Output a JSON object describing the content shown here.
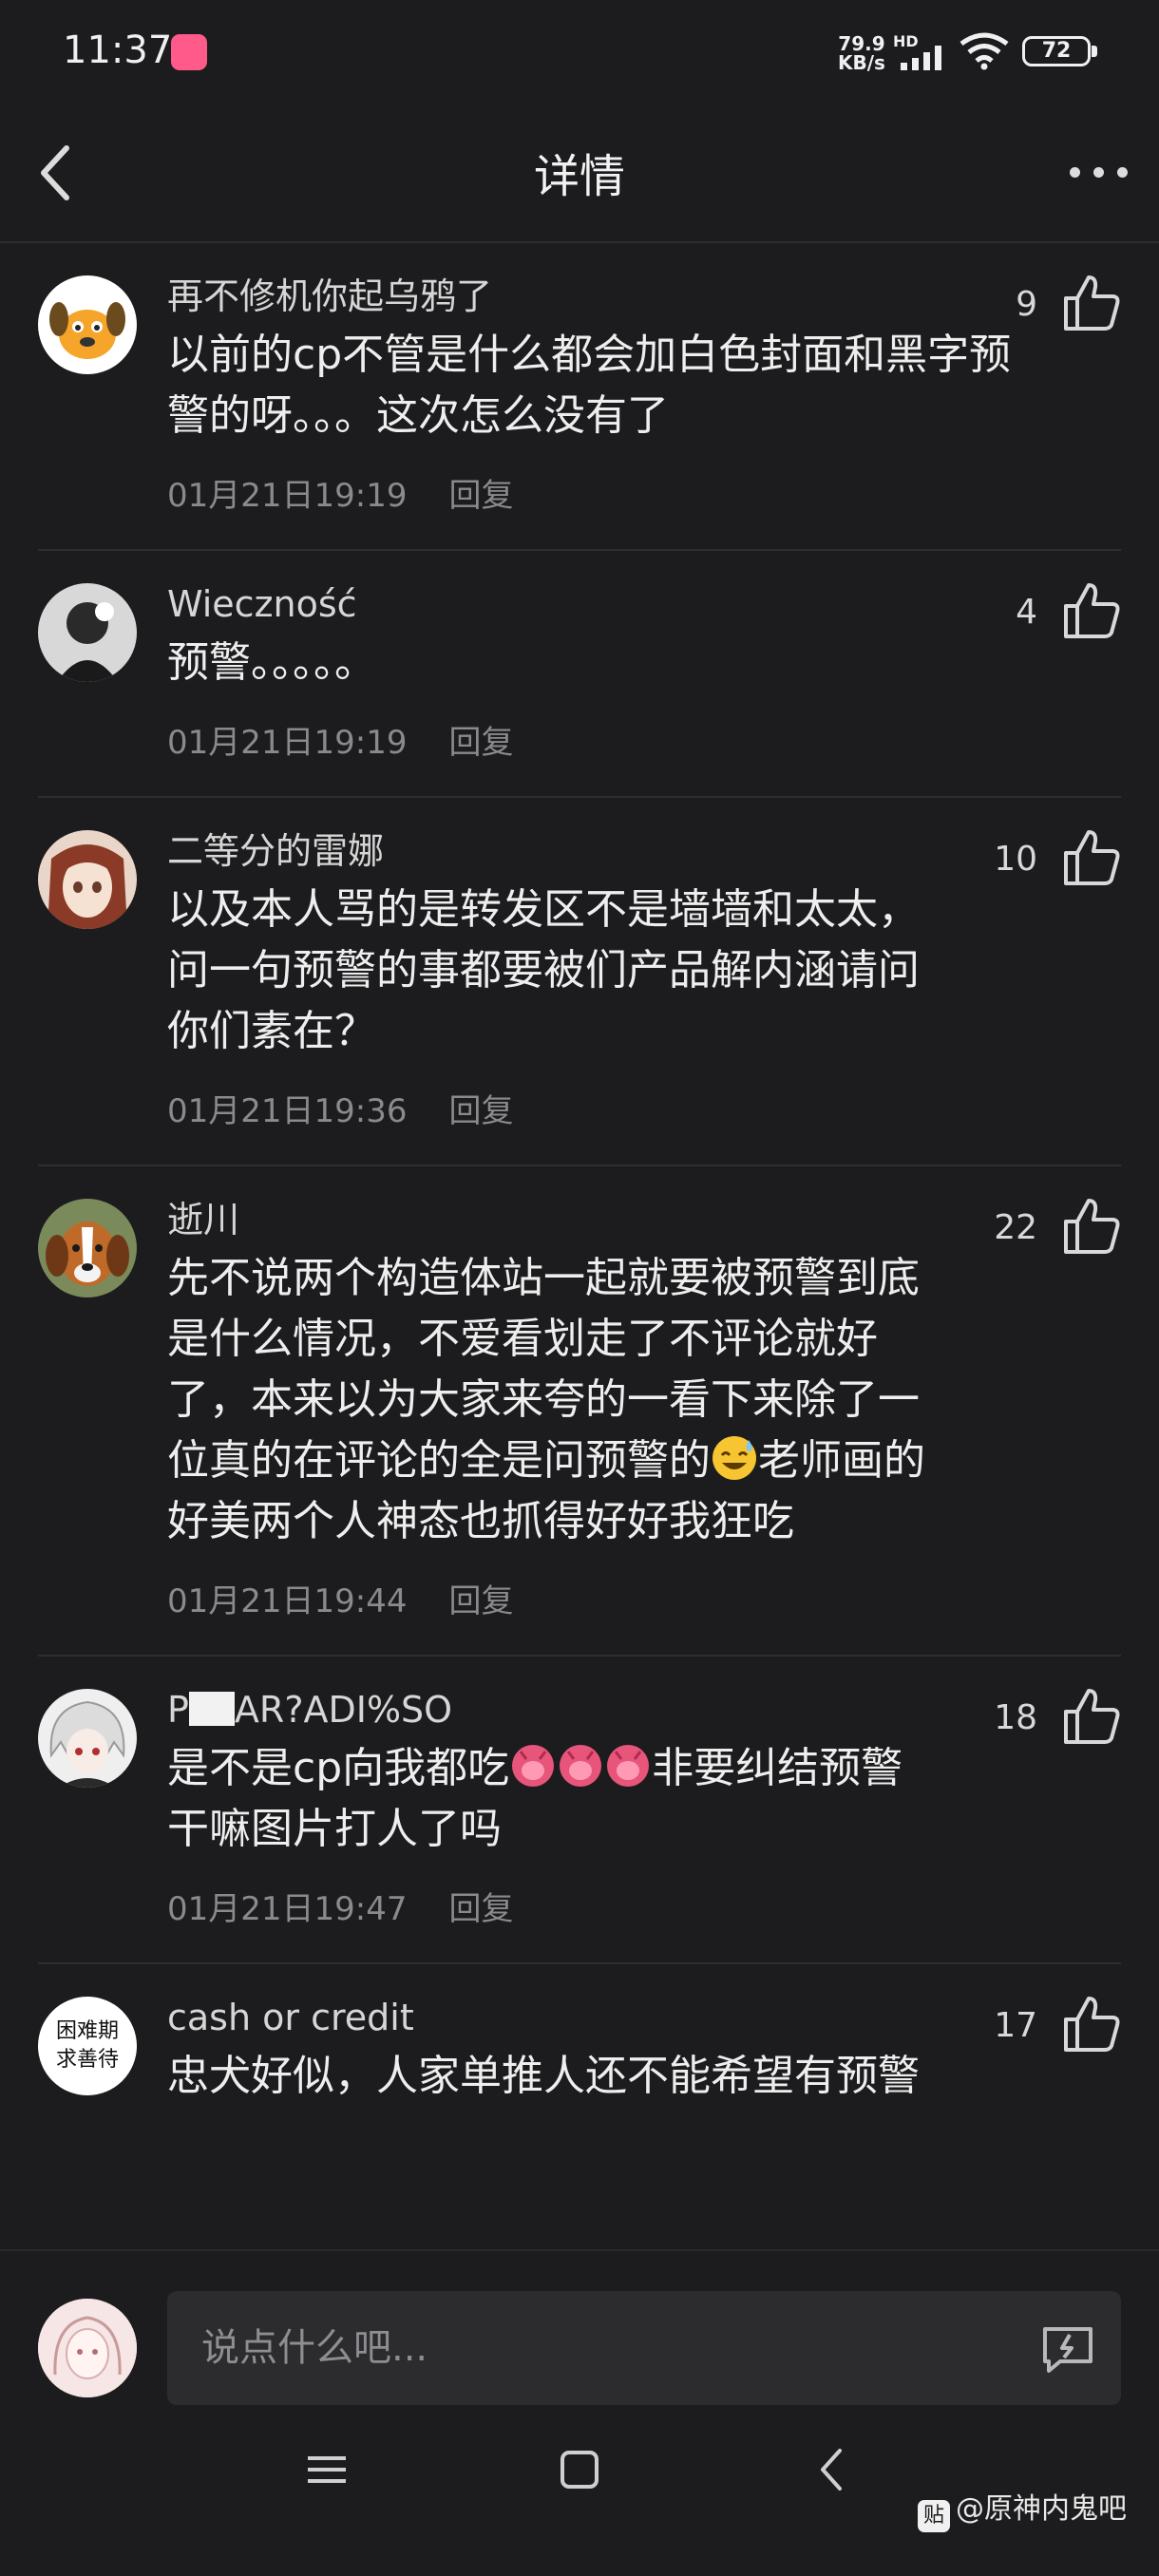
{
  "status_bar": {
    "time": "11:37",
    "net_speed_value": "79.9",
    "net_speed_unit": "KB/s",
    "network_type": "HD",
    "battery": "72"
  },
  "header": {
    "title": "详情"
  },
  "comments": [
    {
      "username": "再不修机你起乌鸦了",
      "text": "以前的cp不管是什么都会加白色封面和黑字预警的呀。。。这次怎么没有了",
      "timestamp": "01月21日19:19",
      "reply_label": "回复",
      "likes": "9"
    },
    {
      "username": "Wieczność",
      "text": "预警。。。。。",
      "timestamp": "01月21日19:19",
      "reply_label": "回复",
      "likes": "4"
    },
    {
      "username": "二等分的雷娜",
      "text_lines": [
        "以及本人骂的是转发区不是墙墙和太太，",
        "问一句预警的事都要被们产品解内涵请问",
        "你们素在？"
      ],
      "timestamp": "01月21日19:36",
      "reply_label": "回复",
      "likes": "10"
    },
    {
      "username": "逝川",
      "text_lines": [
        "先不说两个构造体站一起就要被预警到底",
        "是什么情况，不爱看划走了不评论就好",
        "了，本来以为大家来夸的一看下来除了一",
        "位真的在评论的全是问预警的"
      ],
      "text_after_emoji": "老师画的好美两个人神态也抓得好好我狂吃",
      "text_after_emoji_line1": "老师画的",
      "text_after_emoji_line2": "好美两个人神态也抓得好好我狂吃",
      "emoji": "sweat-smile",
      "timestamp": "01月21日19:44",
      "reply_label": "回复",
      "likes": "22"
    },
    {
      "username_prefix": "P",
      "username_suffix": "AR?ADI%SO",
      "text_prefix": "是不是cp向我都吃",
      "emojis": [
        "tongue",
        "tongue",
        "tongue"
      ],
      "text_suffix": "非要纠结预警",
      "text_line2": "干嘛图片打人了吗",
      "timestamp": "01月21日19:47",
      "reply_label": "回复",
      "likes": "18"
    },
    {
      "username": "cash or credit",
      "avatar_text_line1": "困难期",
      "avatar_text_line2": "求善待",
      "text": "忠犬好似，人家单推人还不能希望有预警",
      "likes": "17"
    }
  ],
  "input": {
    "placeholder": "说点什么吧..."
  },
  "watermark": {
    "icon_text": "贴",
    "text": "@原神内鬼吧"
  },
  "colors": {
    "background": "#1c1c1e",
    "input_background": "#2c2c2e",
    "meta_gray": "#8a8a8e"
  }
}
